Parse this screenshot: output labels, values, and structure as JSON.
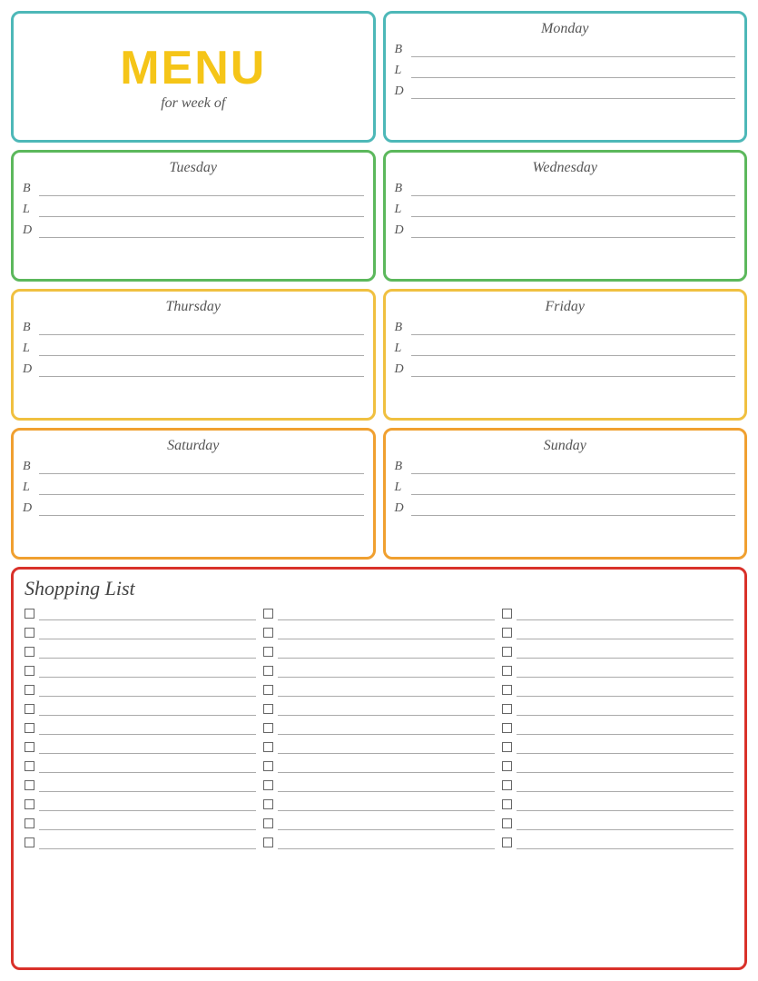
{
  "header": {
    "menu_title": "MENU",
    "menu_subtitle": "for week of"
  },
  "days": [
    {
      "name": "Monday",
      "border_class": "monday-card"
    },
    {
      "name": "Tuesday",
      "border_class": "tuesday-card"
    },
    {
      "name": "Wednesday",
      "border_class": "wednesday-card"
    },
    {
      "name": "Thursday",
      "border_class": "thursday-card"
    },
    {
      "name": "Friday",
      "border_class": "friday-card"
    },
    {
      "name": "Saturday",
      "border_class": "saturday-card"
    },
    {
      "name": "Sunday",
      "border_class": "sunday-card"
    }
  ],
  "meals": [
    "B",
    "L",
    "D"
  ],
  "shopping": {
    "title": "Shopping List",
    "items_per_col": 13,
    "num_cols": 3
  }
}
